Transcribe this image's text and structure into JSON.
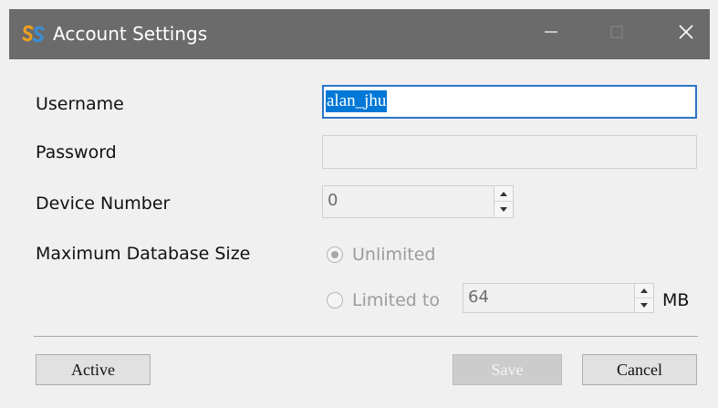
{
  "window": {
    "title": "Account Settings",
    "app_icon": "ss-logo-icon",
    "controls": [
      "minimize-icon",
      "maximize-icon",
      "close-icon"
    ]
  },
  "form": {
    "username": {
      "label": "Username",
      "value": "alan_jhu"
    },
    "password": {
      "label": "Password",
      "value": ""
    },
    "device_number": {
      "label": "Device Number",
      "value": "0"
    },
    "max_db_size": {
      "label": "Maximum Database Size",
      "unlimited_label": "Unlimited",
      "limited_label": "Limited to",
      "limited_value": "64",
      "unit": "MB",
      "selected": "Unlimited"
    }
  },
  "buttons": {
    "active": "Active",
    "save": "Save",
    "cancel": "Cancel"
  },
  "colors": {
    "titlebar": "#6b6b6b",
    "focus_border": "#2b74c7",
    "selection": "#0078d7"
  }
}
